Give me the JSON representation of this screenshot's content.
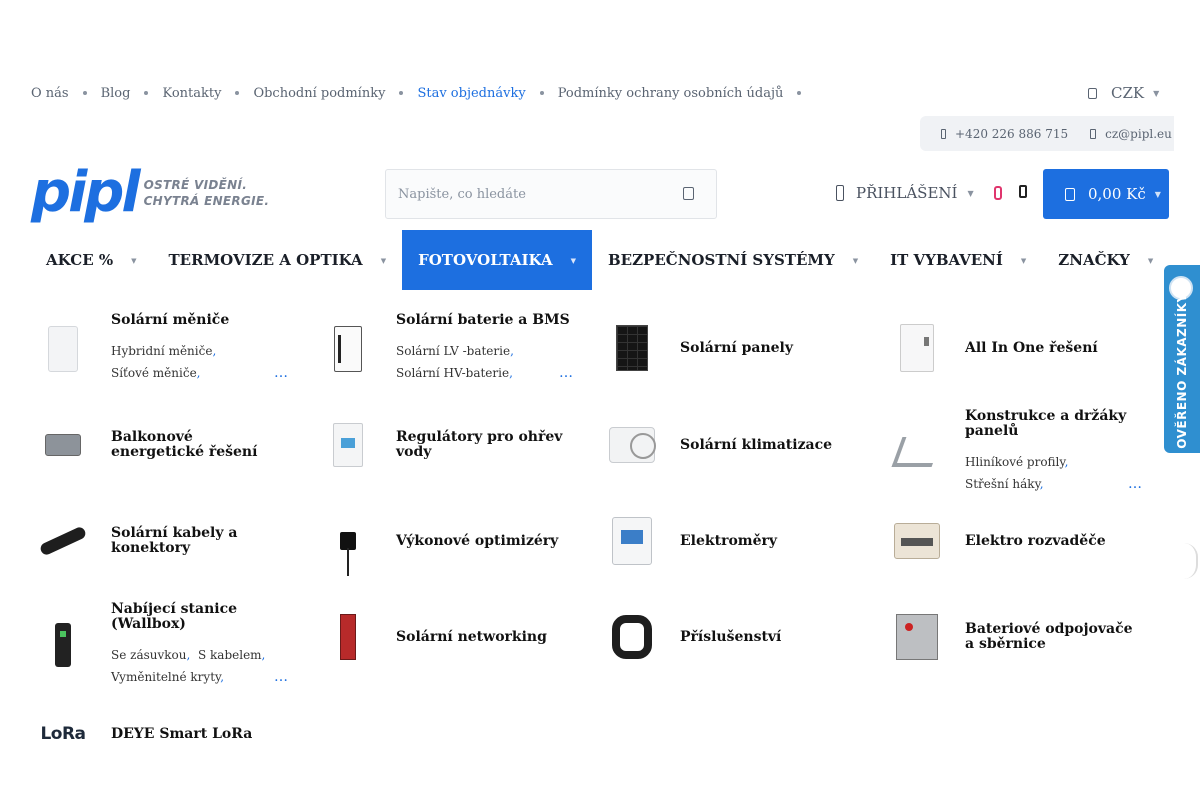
{
  "top_links": [
    {
      "label": "O nás"
    },
    {
      "label": "Blog"
    },
    {
      "label": "Kontakty"
    },
    {
      "label": "Obchodní podmínky"
    },
    {
      "label": "Stav objednávky",
      "active": true
    },
    {
      "label": "Podmínky ochrany osobních údajů"
    }
  ],
  "currency": {
    "label": "CZK"
  },
  "contact": {
    "phone": "+420 226 886 715",
    "email": "cz@pipl.eu"
  },
  "logo": {
    "mark": "pipl",
    "slogan_line1": "OSTRÉ VIDĚNÍ.",
    "slogan_line2": "CHYTRÁ ENERGIE."
  },
  "search": {
    "placeholder": "Napište, co hledáte"
  },
  "account": {
    "login_label": "PŘIHLÁŠENÍ"
  },
  "cart": {
    "total": "0,00 Kč"
  },
  "nav": [
    {
      "label": "AKCE %"
    },
    {
      "label": "TERMOVIZE A OPTIKA"
    },
    {
      "label": "FOTOVOLTAIKA",
      "active": true
    },
    {
      "label": "BEZPEČNOSTNÍ SYSTÉMY"
    },
    {
      "label": "IT VYBAVENÍ"
    },
    {
      "label": "ZNAČKY"
    }
  ],
  "categories": [
    {
      "title": "Solární měniče",
      "subs": [
        "Hybridní měniče",
        "Síťové měniče"
      ],
      "icon": "inverter-image"
    },
    {
      "title": "Solární baterie a BMS",
      "subs": [
        "Solární LV -baterie",
        "Solární HV-baterie"
      ],
      "icon": "battery-image"
    },
    {
      "title": "Solární panely",
      "icon": "solar-panel-image"
    },
    {
      "title": "All In One řešení",
      "icon": "all-in-one-image"
    },
    {
      "title": "Balkonové energetické řešení",
      "icon": "balcony-kit-image"
    },
    {
      "title": "Regulátory pro ohřev vody",
      "icon": "water-heater-regulator-image"
    },
    {
      "title": "Solární klimatizace",
      "icon": "air-conditioner-image"
    },
    {
      "title": "Konstrukce a držáky panelů",
      "subs": [
        "Hliníkové profily",
        "Střešní háky"
      ],
      "icon": "mounting-bracket-image"
    },
    {
      "title": "Solární kabely a konektory",
      "icon": "cable-connector-image"
    },
    {
      "title": "Výkonové optimizéry",
      "icon": "optimizer-image"
    },
    {
      "title": "Elektroměry",
      "icon": "energy-meter-image"
    },
    {
      "title": "Elektro rozvaděče",
      "icon": "distribution-box-image"
    },
    {
      "title": "Nabíjecí stanice (Wallbox)",
      "subs": [
        "Se zásuvkou",
        "S kabelem",
        "Vyměnitelné kryty"
      ],
      "icon": "wallbox-image"
    },
    {
      "title": "Solární networking",
      "icon": "network-switch-image"
    },
    {
      "title": "Příslušenství",
      "icon": "accessory-image"
    },
    {
      "title": "Bateriové odpojovače a sběrnice",
      "icon": "battery-disconnect-image"
    },
    {
      "title": "DEYE Smart LoRa",
      "logo_text": "LoRa",
      "icon": "lora-logo"
    }
  ],
  "more_marker": "…",
  "badge": {
    "text": "OVĚŘENO ZÁKAZNÍKY"
  },
  "colors": {
    "brand": "#1d6fe0",
    "wishlist": "#e0356d",
    "badge": "#2f8fd0"
  }
}
